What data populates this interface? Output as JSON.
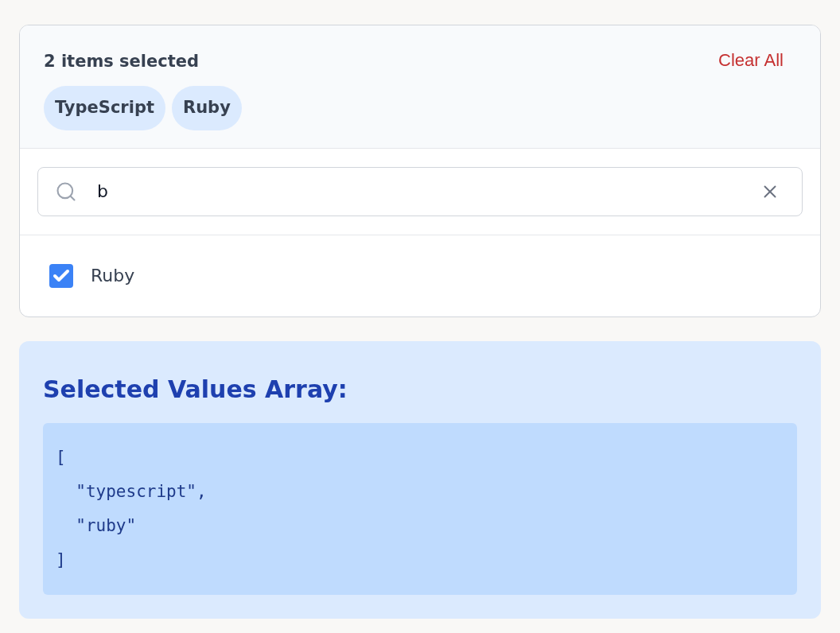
{
  "selection": {
    "summary": "2 items selected",
    "clear_label": "Clear All",
    "chips": [
      "TypeScript",
      "Ruby"
    ]
  },
  "search": {
    "value": "b"
  },
  "options": [
    {
      "label": "Ruby",
      "checked": true
    }
  ],
  "result": {
    "title": "Selected Values Array:",
    "code_lines": [
      "[",
      "  \"typescript\",",
      "  \"ruby\"",
      "]"
    ]
  }
}
